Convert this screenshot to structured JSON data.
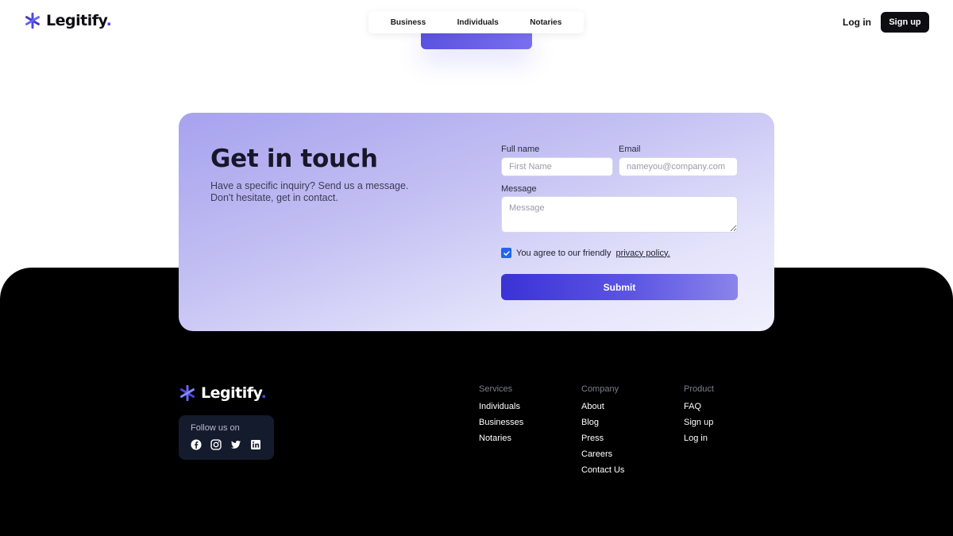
{
  "brand": {
    "name": "Legitify",
    "accent": "#4f46e5"
  },
  "nav": {
    "tabs": [
      {
        "label": "Business"
      },
      {
        "label": "Individuals"
      },
      {
        "label": "Notaries"
      }
    ],
    "login_label": "Log in",
    "signup_label": "Sign up"
  },
  "contact": {
    "title": "Get in touch",
    "subtitle": "Have a specific inquiry? Send us a message. Don't hesitate, get in contact.",
    "full_name_label": "Full name",
    "full_name_placeholder": "First Name",
    "email_label": "Email",
    "email_placeholder": "nameyou@company.com",
    "message_label": "Message",
    "message_placeholder": "Message",
    "agree_text": "You agree to our friendly",
    "agree_link": "privacy policy.",
    "agree_checked": true,
    "submit_label": "Submit"
  },
  "footer": {
    "follow_label": "Follow us on",
    "social_icons": [
      "facebook-icon",
      "instagram-icon",
      "twitter-icon",
      "linkedin-icon"
    ],
    "columns": [
      {
        "heading": "Services",
        "links": [
          "Individuals",
          "Businesses",
          "Notaries"
        ]
      },
      {
        "heading": "Company",
        "links": [
          "About",
          "Blog",
          "Press",
          "Careers",
          "Contact Us"
        ]
      },
      {
        "heading": "Product",
        "links": [
          "FAQ",
          "Sign up",
          "Log in"
        ]
      }
    ]
  }
}
